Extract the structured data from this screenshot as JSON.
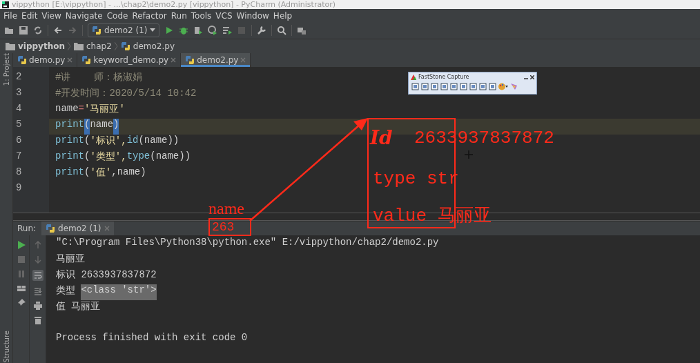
{
  "window": {
    "title": "vippython [E:\\vippython] - ...\\chap2\\demo2.py [vippython] - PyCharm (Administrator)"
  },
  "menu": [
    "File",
    "Edit",
    "View",
    "Navigate",
    "Code",
    "Refactor",
    "Run",
    "Tools",
    "VCS",
    "Window",
    "Help"
  ],
  "toolbar": {
    "run_config": "demo2 (1)"
  },
  "breadcrumbs": [
    "vippython",
    "chap2",
    "demo2.py"
  ],
  "side_tabs": {
    "top": "1: Project",
    "bottom": "Structure"
  },
  "editor_tabs": [
    {
      "label": "demo.py",
      "selected": false
    },
    {
      "label": "keyword_demo.py",
      "selected": false
    },
    {
      "label": "demo2.py",
      "selected": true
    }
  ],
  "editor": {
    "lines": [
      {
        "number": "2",
        "current": false,
        "tokens": [
          {
            "text": "#讲    师：杨淑娟",
            "kind": "comment"
          }
        ]
      },
      {
        "number": "3",
        "current": false,
        "tokens": [
          {
            "text": "#开发时间：2020/5/14 10:42",
            "kind": "comment"
          }
        ]
      },
      {
        "number": "4",
        "current": false,
        "tokens": [
          {
            "text": "name",
            "kind": "plain"
          },
          {
            "text": "=",
            "kind": "operator"
          },
          {
            "text": "'马丽亚'",
            "kind": "string"
          }
        ]
      },
      {
        "number": "5",
        "current": true,
        "tokens": [
          {
            "text": "print",
            "kind": "builtin"
          },
          {
            "text": "(",
            "kind": "match"
          },
          {
            "text": "name",
            "kind": "plain"
          },
          {
            "text": ")",
            "kind": "match"
          }
        ]
      },
      {
        "number": "6",
        "current": false,
        "tokens": [
          {
            "text": "print",
            "kind": "builtin"
          },
          {
            "text": "(",
            "kind": "plain"
          },
          {
            "text": "'标识',",
            "kind": "string"
          },
          {
            "text": "id",
            "kind": "builtin"
          },
          {
            "text": "(name))",
            "kind": "plain"
          }
        ]
      },
      {
        "number": "7",
        "current": false,
        "tokens": [
          {
            "text": "print",
            "kind": "builtin"
          },
          {
            "text": "(",
            "kind": "plain"
          },
          {
            "text": "'类型',",
            "kind": "string"
          },
          {
            "text": "type",
            "kind": "builtin"
          },
          {
            "text": "(name))",
            "kind": "plain"
          }
        ]
      },
      {
        "number": "8",
        "current": false,
        "tokens": [
          {
            "text": "print",
            "kind": "builtin"
          },
          {
            "text": "(",
            "kind": "plain"
          },
          {
            "text": "'值'",
            "kind": "string"
          },
          {
            "text": ",name)",
            "kind": "plain"
          }
        ]
      },
      {
        "number": "9",
        "current": false
      }
    ]
  },
  "run_panel": {
    "label": "Run:",
    "tab": "demo2 (1)",
    "output": [
      [
        {
          "text": "\"C:\\Program Files\\Python38\\python.exe\" E:/vippython/chap2/demo2.py",
          "kind": "plain"
        }
      ],
      [
        {
          "text": "马丽亚",
          "kind": "plain"
        }
      ],
      [
        {
          "text": "标识 2633937837872",
          "kind": "plain"
        }
      ],
      [
        {
          "text": "类型 ",
          "kind": "plain"
        },
        {
          "text": "<class 'str'>",
          "kind": "selected"
        }
      ],
      [
        {
          "text": "值 马丽亚",
          "kind": "plain"
        }
      ]
    ],
    "exit_message": "Process finished with exit code 0"
  },
  "capture_toolbar": {
    "title": "FastStone Capture"
  },
  "annotations": {
    "name_label": "name",
    "boxed_value": "263",
    "id_mark": "Id",
    "id_value": "2633937837872",
    "type_text": "type str",
    "value_text": "value 马丽亚"
  }
}
